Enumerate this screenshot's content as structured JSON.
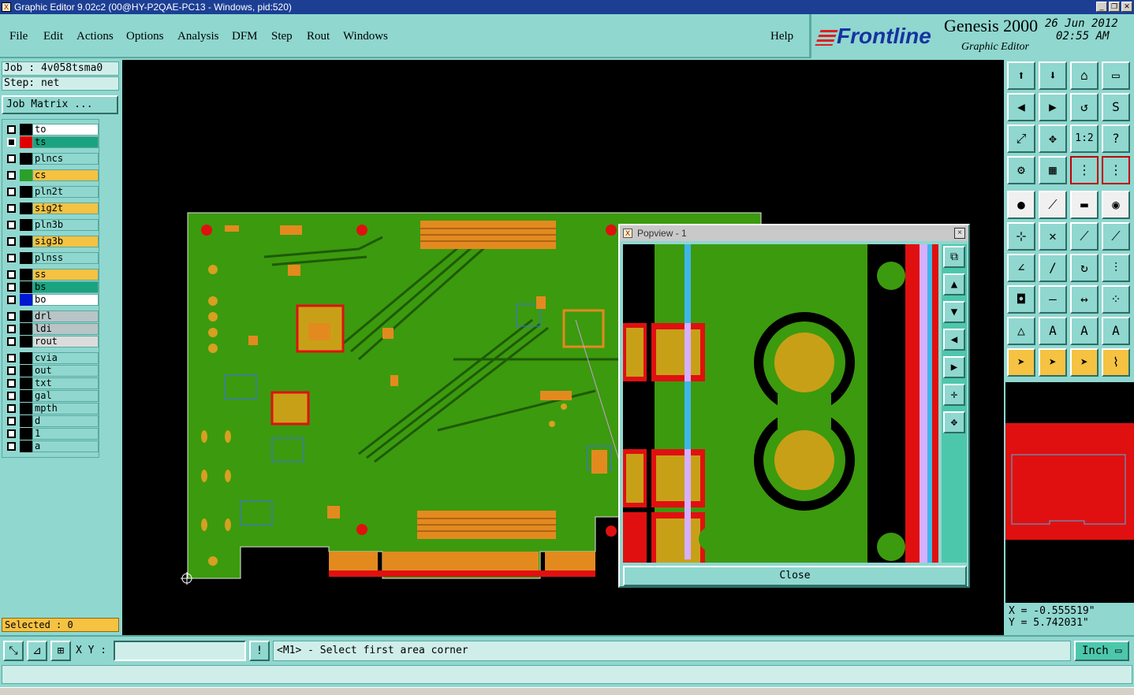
{
  "window": {
    "title": "Graphic Editor 9.02c2 (00@HY-P2QAE-PC13 - Windows, pid:520)",
    "app_icon": "X"
  },
  "menu": [
    "File",
    "Edit",
    "Actions",
    "Options",
    "Analysis",
    "DFM",
    "Step",
    "Rout",
    "Windows",
    "Help"
  ],
  "brand": {
    "logo": "Frontline",
    "product": "Genesis 2000",
    "subtitle": "Graphic Editor",
    "date": "26 Jun 2012",
    "time": "02:55 AM"
  },
  "left_panel": {
    "job": "Job : 4v058tsma0",
    "step": "Step: net",
    "job_matrix": "Job Matrix ...",
    "selected": "Selected : 0"
  },
  "layers": [
    {
      "name": "to",
      "color": "#000000",
      "bg": "#ffffff",
      "checked": false
    },
    {
      "name": "ts",
      "color": "#e00000",
      "bg": "#1aa37f",
      "checked": true
    },
    {
      "name": "plncs",
      "color": "#000000",
      "bg": "#8fd7cf",
      "checked": false
    },
    {
      "name": "cs",
      "color": "#2aa02a",
      "bg": "#f5c242",
      "checked": false
    },
    {
      "name": "pln2t",
      "color": "#000000",
      "bg": "#8fd7cf",
      "checked": false
    },
    {
      "name": "sig2t",
      "color": "#000000",
      "bg": "#f5c242",
      "checked": false
    },
    {
      "name": "pln3b",
      "color": "#000000",
      "bg": "#8fd7cf",
      "checked": false
    },
    {
      "name": "sig3b",
      "color": "#000000",
      "bg": "#f5c242",
      "checked": false
    },
    {
      "name": "plnss",
      "color": "#000000",
      "bg": "#8fd7cf",
      "checked": false
    },
    {
      "name": "ss",
      "color": "#000000",
      "bg": "#f5c242",
      "checked": false
    },
    {
      "name": "bs",
      "color": "#000000",
      "bg": "#1aa37f",
      "checked": false
    },
    {
      "name": "bo",
      "color": "#0018d0",
      "bg": "#ffffff",
      "checked": false
    },
    {
      "name": "drl",
      "color": "#000000",
      "bg": "#b8c4c6",
      "checked": false
    },
    {
      "name": "ldi",
      "color": "#000000",
      "bg": "#b8c4c6",
      "checked": false
    },
    {
      "name": "rout",
      "color": "#000000",
      "bg": "#dcdcdc",
      "checked": false
    },
    {
      "name": "cvia",
      "color": "#000000",
      "bg": "#8fd7cf",
      "checked": false
    },
    {
      "name": "out",
      "color": "#000000",
      "bg": "#8fd7cf",
      "checked": false
    },
    {
      "name": "txt",
      "color": "#000000",
      "bg": "#8fd7cf",
      "checked": false
    },
    {
      "name": "gal",
      "color": "#000000",
      "bg": "#8fd7cf",
      "checked": false
    },
    {
      "name": "mpth",
      "color": "#000000",
      "bg": "#8fd7cf",
      "checked": false
    },
    {
      "name": "d",
      "color": "#000000",
      "bg": "#8fd7cf",
      "checked": false
    },
    {
      "name": "1",
      "color": "#000000",
      "bg": "#8fd7cf",
      "checked": false
    },
    {
      "name": "a",
      "color": "#000000",
      "bg": "#8fd7cf",
      "checked": false
    }
  ],
  "popview": {
    "title": "Popview - 1",
    "close_label": "Close",
    "close_x": "×"
  },
  "bottom": {
    "xy_label": "X Y :",
    "xy_value": "",
    "prompt": "<M1> - Select first area corner",
    "unit": "Inch"
  },
  "coords": {
    "x": "X = -0.555519\"",
    "y": "Y = 5.742031\""
  },
  "colors": {
    "panel_bg": "#8fd7cf",
    "board_green": "#3c9a0e",
    "pad_orange": "#e38a1f",
    "accent_red": "#e01010"
  }
}
